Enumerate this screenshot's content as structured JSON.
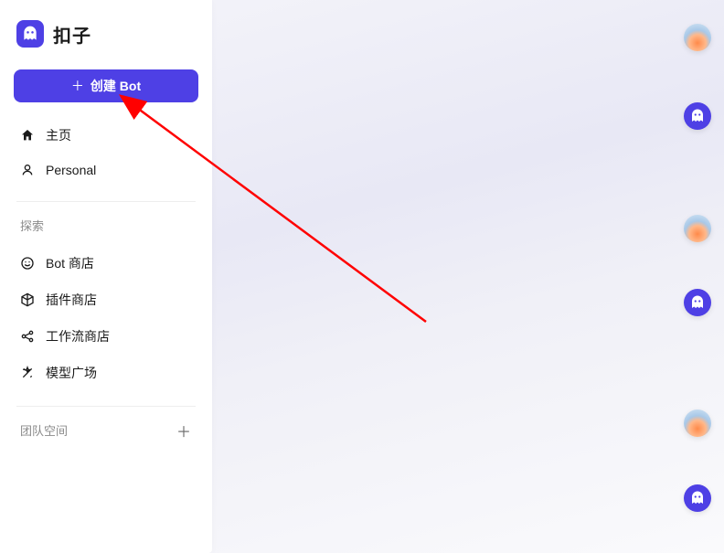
{
  "brand": {
    "title": "扣子"
  },
  "create": {
    "label": "创建 Bot"
  },
  "nav_top": [
    {
      "label": "主页",
      "icon": "home"
    },
    {
      "label": "Personal",
      "icon": "person"
    }
  ],
  "explore": {
    "header": "探索",
    "items": [
      {
        "label": "Bot 商店",
        "icon": "smile"
      },
      {
        "label": "插件商店",
        "icon": "cube"
      },
      {
        "label": "工作流商店",
        "icon": "share"
      },
      {
        "label": "模型广场",
        "icon": "sparkle"
      }
    ]
  },
  "team": {
    "header": "团队空间"
  },
  "colors": {
    "accent": "#4e40e5"
  },
  "annotation": {
    "arrow_color": "#ff0000"
  }
}
